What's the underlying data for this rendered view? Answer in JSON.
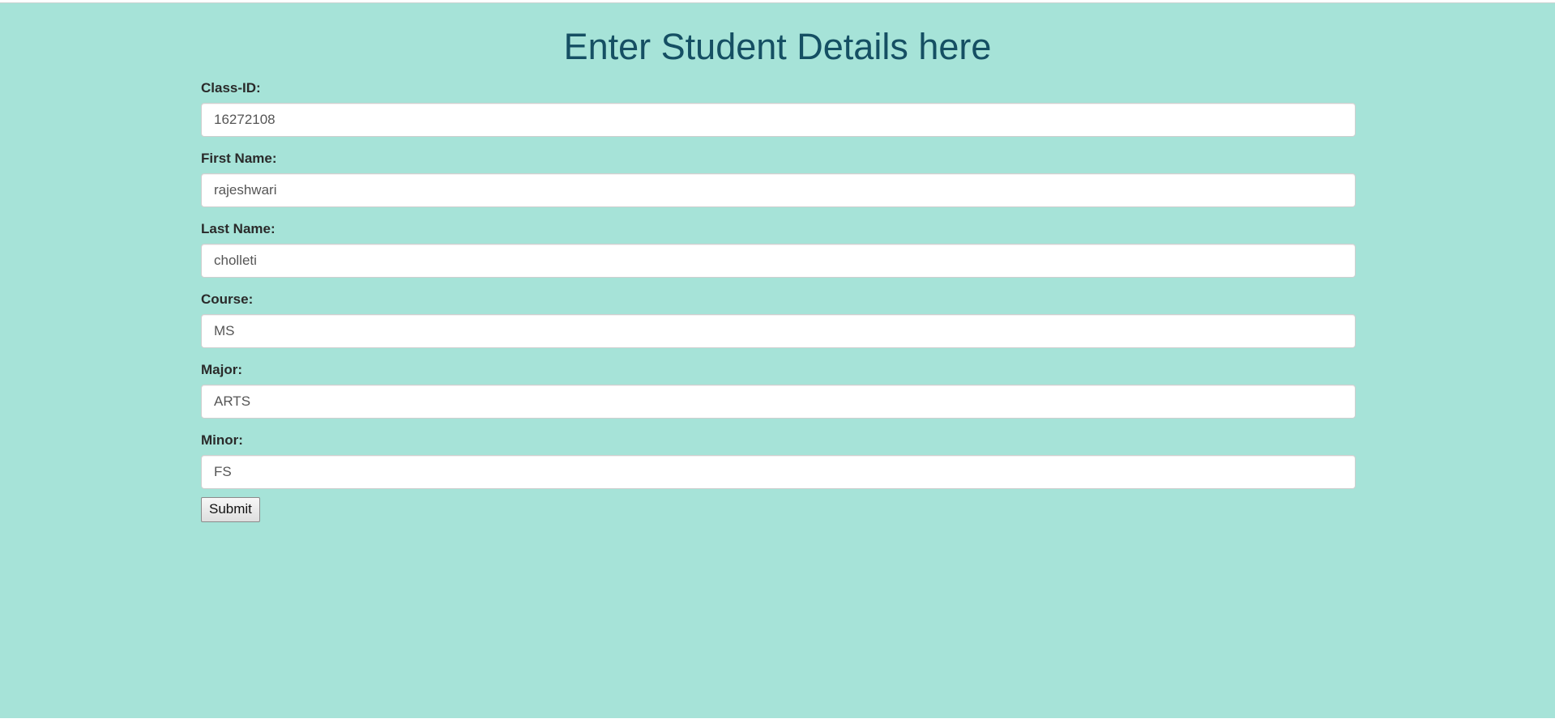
{
  "title": "Enter Student Details here",
  "fields": [
    {
      "label": "Class-ID:",
      "value": "16272108"
    },
    {
      "label": "First Name:",
      "value": "rajeshwari"
    },
    {
      "label": "Last Name:",
      "value": "cholleti"
    },
    {
      "label": "Course:",
      "value": "MS"
    },
    {
      "label": "Major:",
      "value": "ARTS"
    },
    {
      "label": "Minor:",
      "value": "FS"
    }
  ],
  "submit_label": "Submit",
  "colors": {
    "background": "#a6e3d8",
    "title": "#154f63",
    "label": "#2a2a2a"
  }
}
